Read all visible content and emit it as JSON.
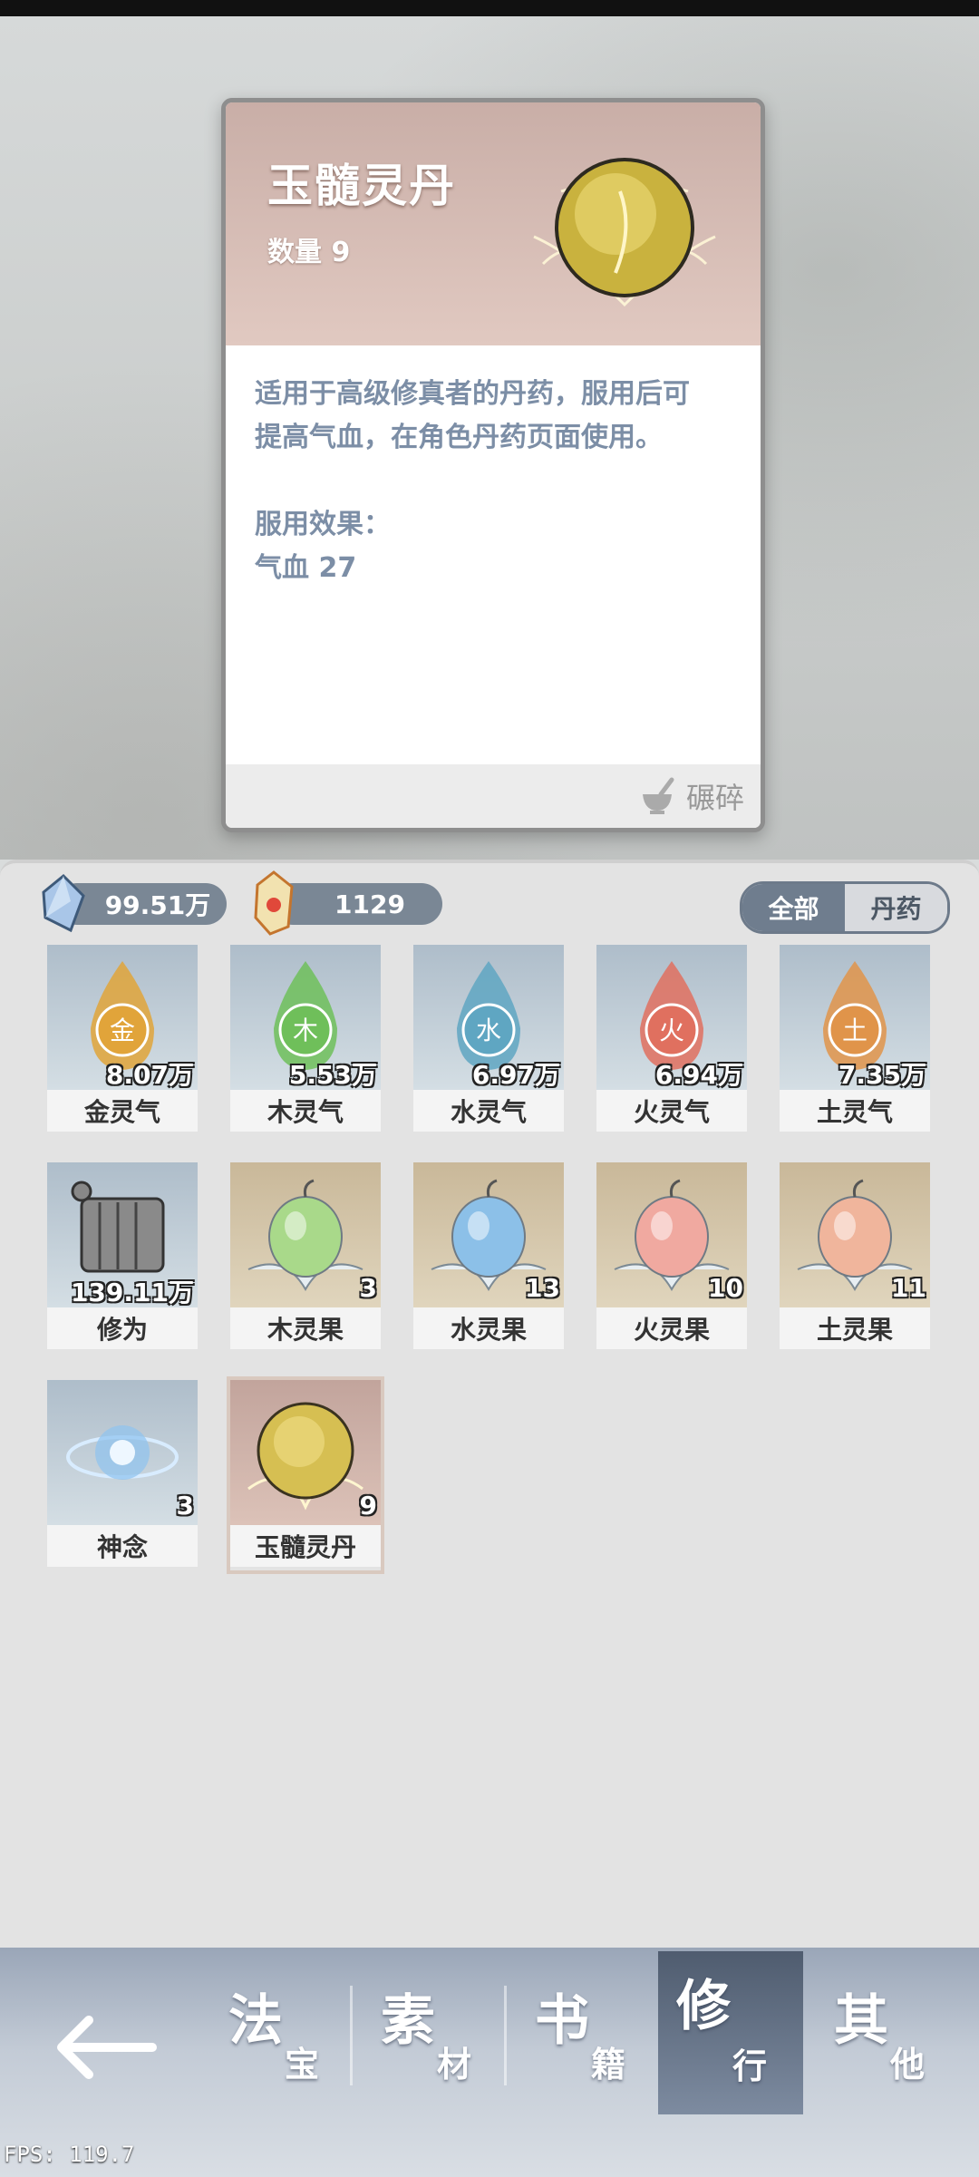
{
  "detail": {
    "title": "玉髓灵丹",
    "quantity": "数量 9",
    "description_lines": [
      "适用于高级修真者的丹药，服用后可",
      "提高气血，在角色丹药页面使用。"
    ],
    "effect_title": "服用效果：",
    "effect_value": "气血 27",
    "grind_label": "碾碎",
    "grind_icon": "mortar-icon"
  },
  "resources": [
    {
      "icon": "spirit-crystal-icon",
      "value": "99.51万"
    },
    {
      "icon": "talisman-gem-icon",
      "value": "1129"
    }
  ],
  "filter": {
    "all_label": "全部",
    "pill_label": "丹药",
    "selected": "全部"
  },
  "items": [
    {
      "name": "金灵气",
      "count": "8.07万",
      "icon": "metal-essence-icon",
      "bg": "blue",
      "color": "#e1a43a",
      "glyph": "金"
    },
    {
      "name": "木灵气",
      "count": "5.53万",
      "icon": "wood-essence-icon",
      "bg": "blue",
      "color": "#6fbf5a",
      "glyph": "木"
    },
    {
      "name": "水灵气",
      "count": "6.97万",
      "icon": "water-essence-icon",
      "bg": "blue",
      "color": "#5fa6c2",
      "glyph": "水"
    },
    {
      "name": "火灵气",
      "count": "6.94万",
      "icon": "fire-essence-icon",
      "bg": "blue",
      "color": "#e0705f",
      "glyph": "火"
    },
    {
      "name": "土灵气",
      "count": "7.35万",
      "icon": "earth-essence-icon",
      "bg": "blue",
      "color": "#e0944a",
      "glyph": "土"
    },
    {
      "name": "修为",
      "count": "139.11万",
      "icon": "scroll-icon",
      "bg": "blue",
      "color": "#777777",
      "glyph": ""
    },
    {
      "name": "木灵果",
      "count": "3",
      "icon": "wood-fruit-icon",
      "bg": "tan",
      "color": "#a9d98a",
      "glyph": ""
    },
    {
      "name": "水灵果",
      "count": "13",
      "icon": "water-fruit-icon",
      "bg": "tan",
      "color": "#8cc0e8",
      "glyph": ""
    },
    {
      "name": "火灵果",
      "count": "10",
      "icon": "fire-fruit-icon",
      "bg": "tan",
      "color": "#f0a9a0",
      "glyph": ""
    },
    {
      "name": "土灵果",
      "count": "11",
      "icon": "earth-fruit-icon",
      "bg": "tan",
      "color": "#f0b59c",
      "glyph": ""
    },
    {
      "name": "神念",
      "count": "3",
      "icon": "spirit-swirl-icon",
      "bg": "blue",
      "color": "#8fc3f0",
      "glyph": ""
    },
    {
      "name": "玉髓灵丹",
      "count": "9",
      "icon": "jade-pill-icon",
      "bg": "pink",
      "color": "#d6bf52",
      "glyph": ""
    }
  ],
  "nav": {
    "back_icon": "back-arrow-icon",
    "tabs": [
      {
        "big": "法",
        "small": "宝"
      },
      {
        "big": "素",
        "small": "材"
      },
      {
        "big": "书",
        "small": "籍"
      },
      {
        "big": "修",
        "small": "行"
      },
      {
        "big": "其",
        "small": "他"
      }
    ],
    "active": "修行"
  },
  "fps": "FPS: 119.7"
}
